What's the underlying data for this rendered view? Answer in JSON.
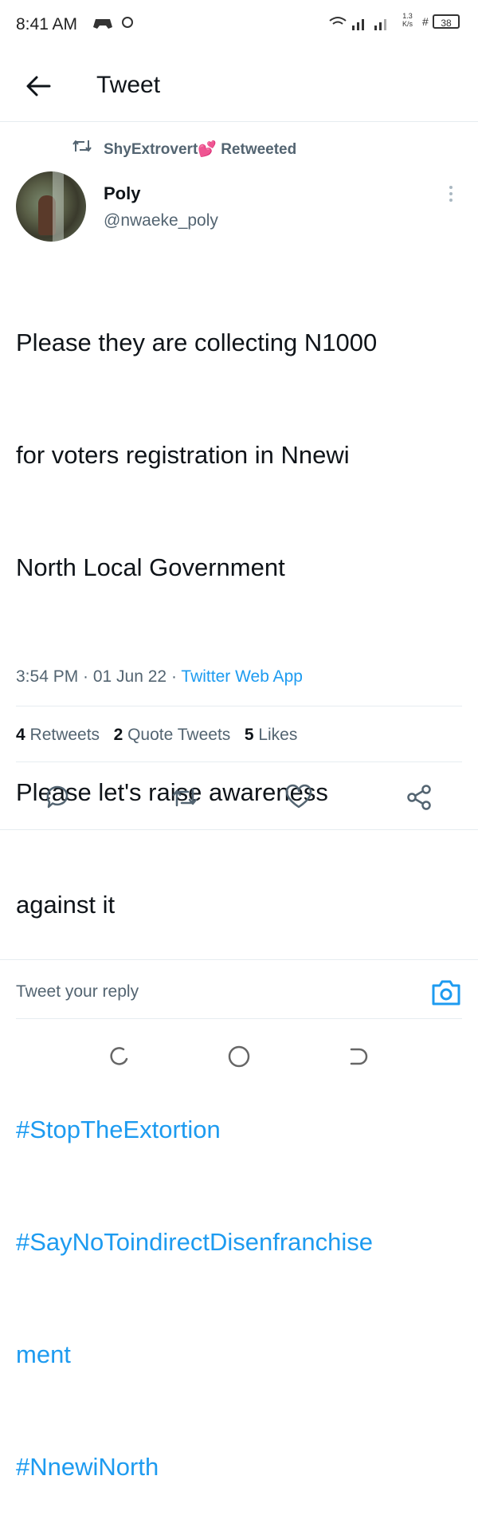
{
  "status_bar": {
    "time": "8:41 AM",
    "net_speed": "1.3",
    "net_unit": "K/s",
    "battery": "38"
  },
  "header": {
    "title": "Tweet",
    "back_icon": "arrow-left-icon"
  },
  "tweet": {
    "retweeted_by": "ShyExtrovert💕 Retweeted",
    "author_name": "Poly",
    "author_handle": "@nwaeke_poly",
    "text_lines": [
      "Please they are collecting N1000",
      "for voters registration in Nnewi",
      "North Local Government",
      "",
      "Please let's raise awareness",
      "against it",
      ""
    ],
    "hashtags": [
      "#StopTheExtortion",
      "#SayNoToindirectDisenfranchise",
      "ment",
      "#NnewiNorth"
    ],
    "timestamp": "3:54 PM · 01 Jun 22 · ",
    "source": "Twitter Web App",
    "stats": {
      "retweets_count": "4",
      "retweets_label": " Retweets",
      "quotes_count": "2",
      "quotes_label": " Quote Tweets",
      "likes_count": "5",
      "likes_label": " Likes"
    }
  },
  "reply": {
    "placeholder": "Tweet your reply"
  },
  "colors": {
    "accent": "#1d9bf0",
    "muted": "#536471",
    "text": "#0f1419"
  }
}
